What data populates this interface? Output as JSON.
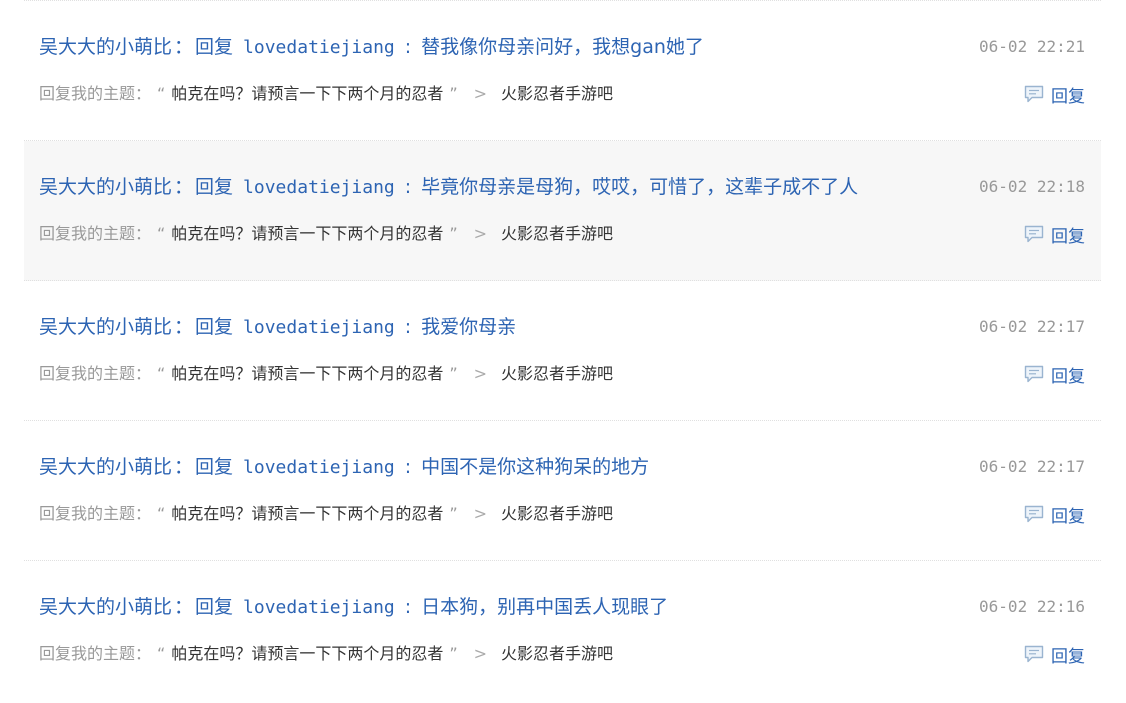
{
  "accent_color": "#2d64b3",
  "icons": {
    "reply_action": "comment-bubble-icon",
    "breadcrumb": "chevron-right-icon"
  },
  "replies": [
    {
      "author": "吴大大的小萌比",
      "reply_word": "回复",
      "target_user": "lovedatiejiang",
      "content": "替我像你母亲问好，我想gan她了",
      "time": "06-02 22:21",
      "topic_prefix": "回复我的主题：",
      "quote_open": "“",
      "topic_title": "帕克在吗？请预言一下下两个月的忍者",
      "quote_close": "”",
      "arrow": ">",
      "forum": "火影忍者手游吧",
      "action_label": "回复"
    },
    {
      "author": "吴大大的小萌比",
      "reply_word": "回复",
      "target_user": "lovedatiejiang",
      "content": "毕竟你母亲是母狗，哎哎，可惜了，这辈子成不了人",
      "time": "06-02 22:18",
      "topic_prefix": "回复我的主题：",
      "quote_open": "“",
      "topic_title": "帕克在吗？请预言一下下两个月的忍者",
      "quote_close": "”",
      "arrow": ">",
      "forum": "火影忍者手游吧",
      "action_label": "回复"
    },
    {
      "author": "吴大大的小萌比",
      "reply_word": "回复",
      "target_user": "lovedatiejiang",
      "content": "我爱你母亲",
      "time": "06-02 22:17",
      "topic_prefix": "回复我的主题：",
      "quote_open": "“",
      "topic_title": "帕克在吗？请预言一下下两个月的忍者",
      "quote_close": "”",
      "arrow": ">",
      "forum": "火影忍者手游吧",
      "action_label": "回复"
    },
    {
      "author": "吴大大的小萌比",
      "reply_word": "回复",
      "target_user": "lovedatiejiang",
      "content": "中国不是你这种狗呆的地方",
      "time": "06-02 22:17",
      "topic_prefix": "回复我的主题：",
      "quote_open": "“",
      "topic_title": "帕克在吗？请预言一下下两个月的忍者",
      "quote_close": "”",
      "arrow": ">",
      "forum": "火影忍者手游吧",
      "action_label": "回复"
    },
    {
      "author": "吴大大的小萌比",
      "reply_word": "回复",
      "target_user": "lovedatiejiang",
      "content": "日本狗，别再中国丢人现眼了",
      "time": "06-02 22:16",
      "topic_prefix": "回复我的主题：",
      "quote_open": "“",
      "topic_title": "帕克在吗？请预言一下下两个月的忍者",
      "quote_close": "”",
      "arrow": ">",
      "forum": "火影忍者手游吧",
      "action_label": "回复"
    }
  ]
}
